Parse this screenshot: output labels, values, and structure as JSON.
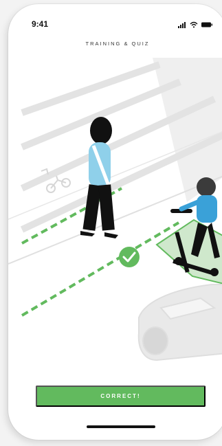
{
  "status_bar": {
    "time": "9:41"
  },
  "header": {
    "title": "TRAINING & QUIZ"
  },
  "cta": {
    "label": "CORRECT!"
  },
  "icons": {
    "signal": "signal-icon",
    "wifi": "wifi-icon",
    "battery": "battery-icon",
    "check": "checkmark-icon",
    "bike_lane": "bike-lane-icon"
  },
  "colors": {
    "accent": "#62ba5e",
    "bike_lane_mat": "#cfe8cc",
    "pedestrian_top": "#8fd0ea",
    "rider_top": "#3aa1d8"
  }
}
